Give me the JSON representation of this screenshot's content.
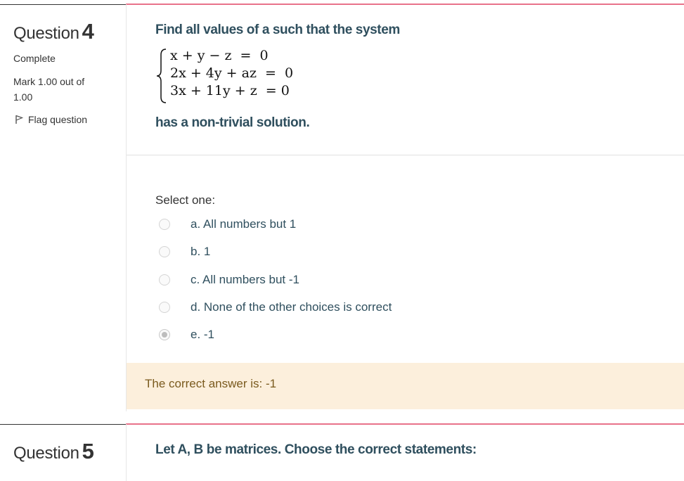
{
  "question4": {
    "label": "Question",
    "number": "4",
    "state": "Complete",
    "grade": "Mark 1.00 out of 1.00",
    "flag": "Flag question",
    "text": "Find all values of a such that the system",
    "equations": [
      "x + y − z  =  0",
      "2x + 4y + az  =  0",
      "3x + 11y + z  = 0"
    ],
    "text_after": "has a non-trivial solution.",
    "prompt": "Select one:",
    "options": [
      {
        "label": "a. All numbers but 1",
        "checked": false
      },
      {
        "label": "b. 1",
        "checked": false
      },
      {
        "label": "c. All numbers but -1",
        "checked": false
      },
      {
        "label": "d. None of the other choices is correct",
        "checked": false
      },
      {
        "label": "e. -1",
        "checked": true
      }
    ],
    "feedback": "The correct answer is: -1"
  },
  "question5": {
    "label": "Question",
    "number": "5",
    "text": "Let A, B be matrices. Choose the correct statements:"
  },
  "colors": {
    "accent_border": "#e8728a",
    "question_text": "#2f4f5e",
    "feedback_bg": "#fcefdc",
    "feedback_text": "#7a5a1e"
  }
}
